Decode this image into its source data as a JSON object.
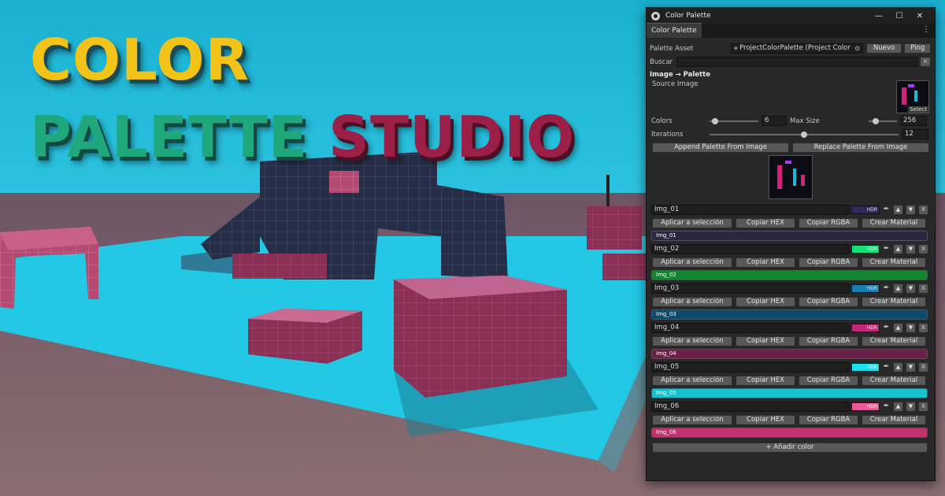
{
  "title": {
    "line1": "COLOR",
    "line2_a": "PALETTE",
    "line2_b": "STUDIO"
  },
  "window": {
    "title": "Color Palette",
    "tab": "Color Palette",
    "palette_asset_label": "Palette Asset",
    "palette_asset_value": "ProjectColorPalette (Project Color Pale",
    "nuevo_label": "Nuevo",
    "ping_label": "Ping",
    "buscar_label": "Buscar",
    "buscar_value": "",
    "clear_label": "×",
    "image_section": "Image → Palette",
    "source_image_label": "Source Image",
    "select_label": "Select",
    "colors_label": "Colors",
    "colors_value": "6",
    "colors_level": 0.12,
    "max_size_label": "Max Size",
    "max_size_value": "256",
    "max_size_level": 0.25,
    "iterations_label": "Iterations",
    "iterations_value": "12",
    "iterations_level": 0.5,
    "append_label": "Append Palette From Image",
    "replace_label": "Replace Palette From Image",
    "add_color_label": "+ Añadir color"
  },
  "item_actions": {
    "apply": "Aplicar a selección",
    "hex": "Copiar HEX",
    "rgba": "Copiar RGBA",
    "material": "Crear Material",
    "hdr": "HDR",
    "up": "▲",
    "down": "▼",
    "remove": "X"
  },
  "colors": [
    {
      "name": "Img_01",
      "hex": "#2b2742"
    },
    {
      "name": "Img_02",
      "hex": "#13842f"
    },
    {
      "name": "Img_03",
      "hex": "#0e4a6b"
    },
    {
      "name": "Img_04",
      "hex": "#6a2148"
    },
    {
      "name": "Img_05",
      "hex": "#16c2cf"
    },
    {
      "name": "Img_06",
      "hex": "#c1316e"
    }
  ],
  "swatch_colors": [
    "#2e2a55",
    "#16e07a",
    "#1a7fb0",
    "#c1287a",
    "#1de0ee",
    "#e85a9c"
  ]
}
